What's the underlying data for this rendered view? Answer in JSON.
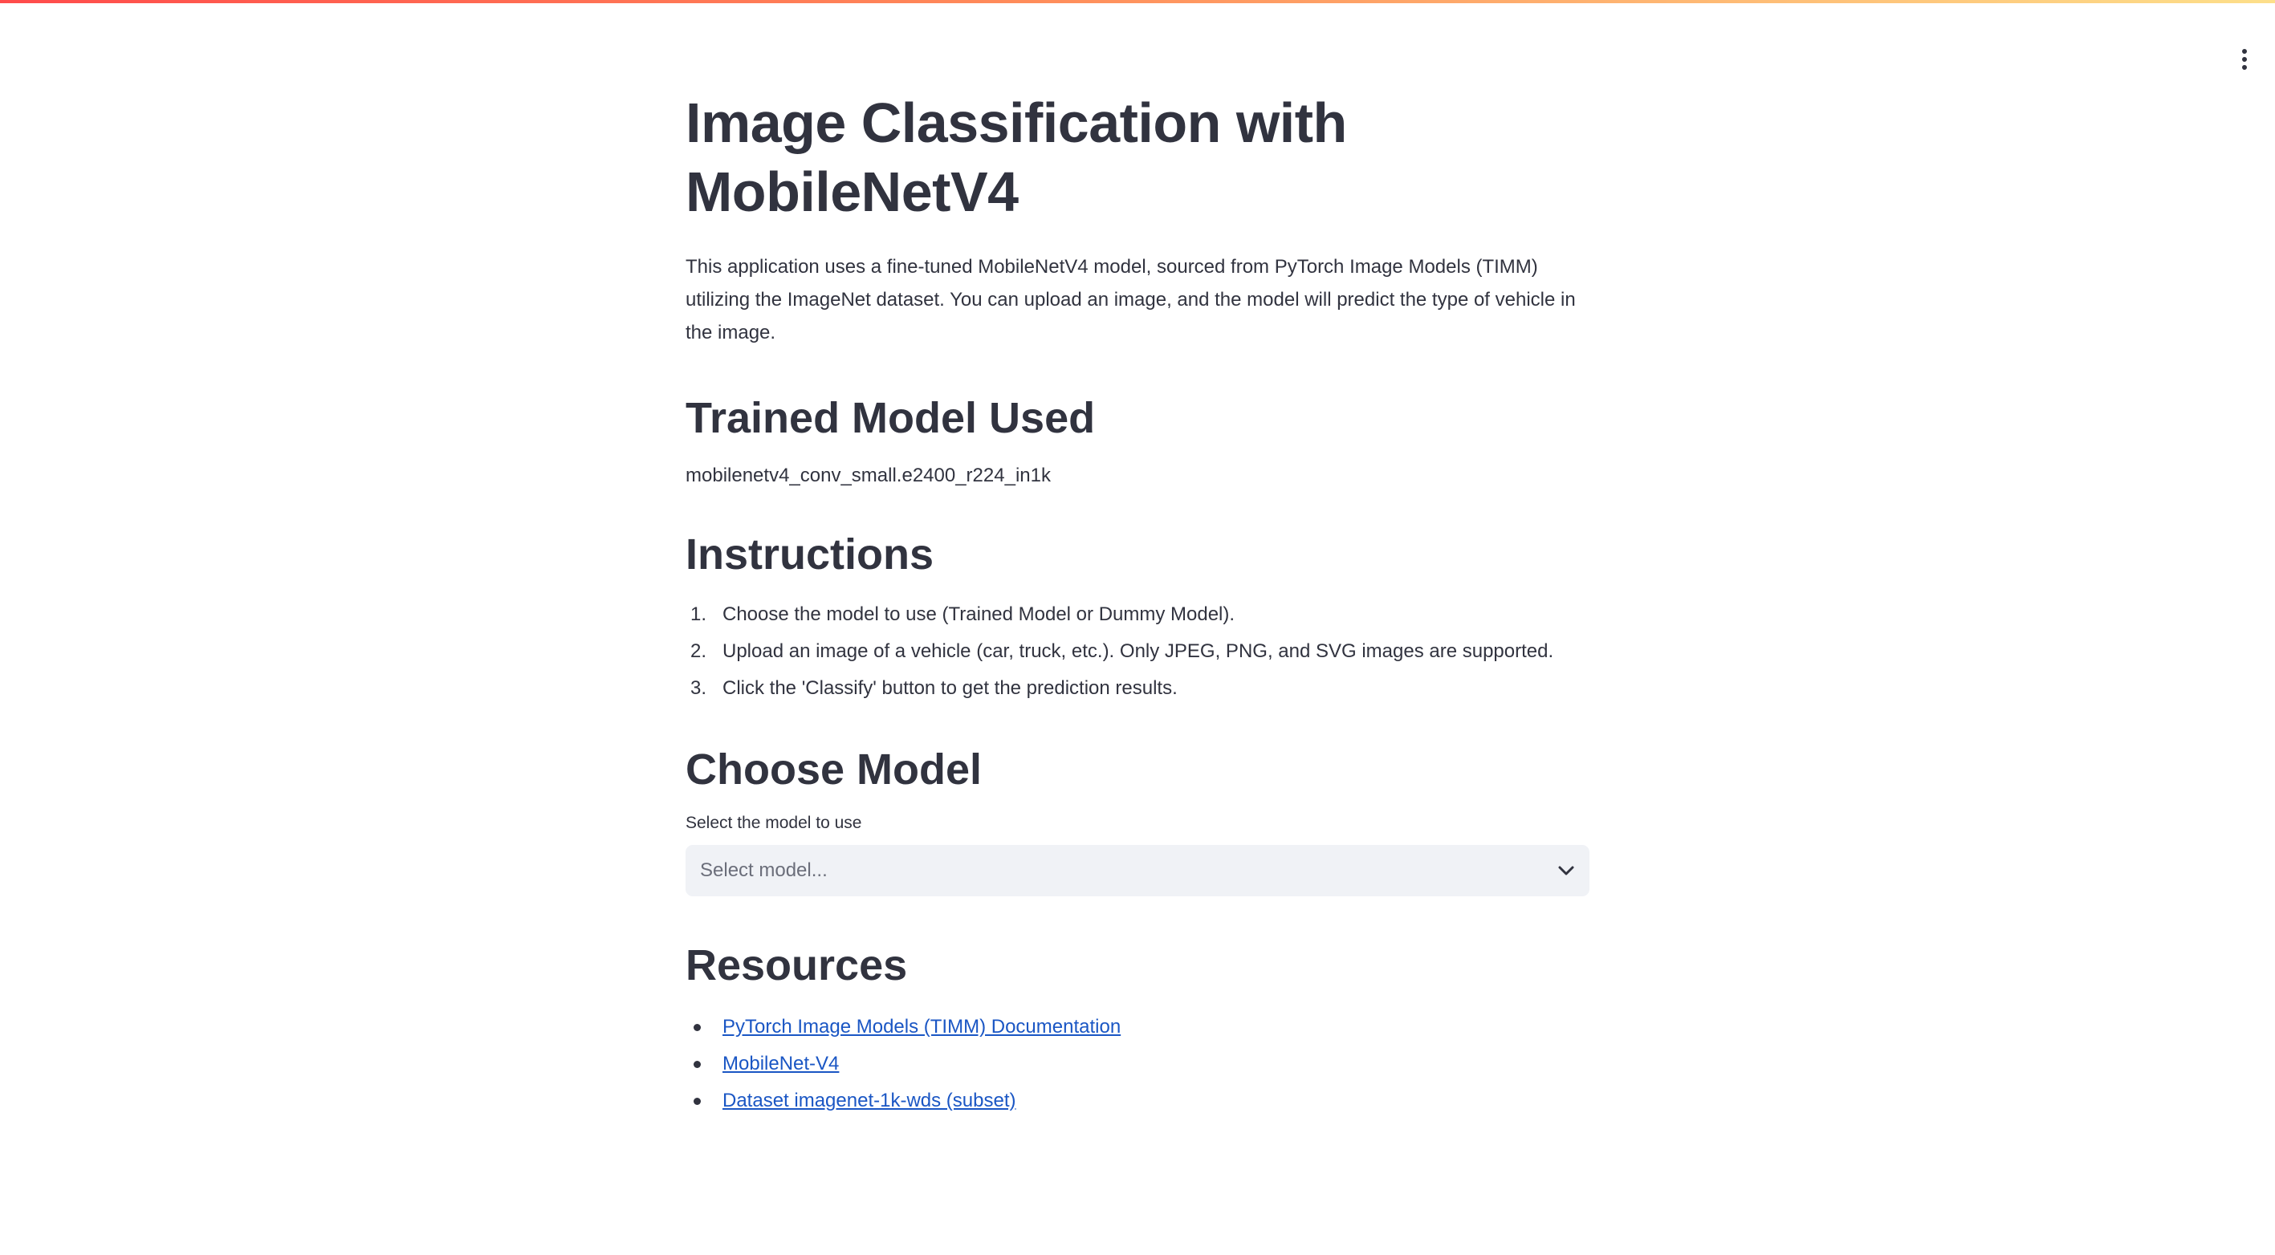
{
  "page": {
    "title": "Image Classification with MobileNetV4",
    "intro": "This application uses a fine-tuned MobileNetV4 model, sourced from PyTorch Image Models (TIMM) utilizing the ImageNet dataset. You can upload an image, and the model will predict the type of vehicle in the image."
  },
  "trained_model": {
    "heading": "Trained Model Used",
    "name": "mobilenetv4_conv_small.e2400_r224_in1k"
  },
  "instructions": {
    "heading": "Instructions",
    "steps": [
      {
        "num": "1.",
        "text": "Choose the model to use (Trained Model or Dummy Model)."
      },
      {
        "num": "2.",
        "text": "Upload an image of a vehicle (car, truck, etc.). Only JPEG, PNG, and SVG images are supported."
      },
      {
        "num": "3.",
        "text": "Click the 'Classify' button to get the prediction results."
      }
    ]
  },
  "choose_model": {
    "heading": "Choose Model",
    "select_label": "Select the model to use",
    "select_placeholder": "Select model..."
  },
  "resources": {
    "heading": "Resources",
    "links": [
      "PyTorch Image Models (TIMM) Documentation",
      "MobileNet-V4",
      "Dataset imagenet-1k-wds (subset)"
    ]
  },
  "icons": {
    "menu": "kebab-menu-icon",
    "select_arrow": "chevron-down-icon"
  },
  "colors": {
    "text": "#31333f",
    "link": "#1a56c4",
    "select_bg": "#f0f2f6",
    "accent_start": "#ff4b4b",
    "accent_end": "#fddf8a"
  }
}
